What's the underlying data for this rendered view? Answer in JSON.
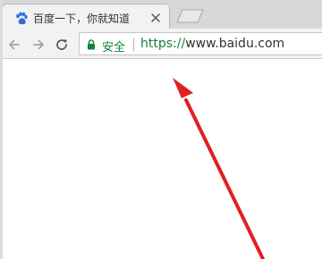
{
  "browser": {
    "tab": {
      "title": "百度一下，你就知道",
      "favicon": "baidu-paw-icon",
      "close_icon": "close-icon"
    },
    "new_tab_icon": "new-tab-icon",
    "nav": {
      "back_icon": "back-arrow-icon",
      "forward_icon": "forward-arrow-icon",
      "reload_icon": "reload-icon"
    },
    "address": {
      "security_label": "安全",
      "url_scheme": "https://",
      "url_host": "www.baidu.com"
    }
  },
  "annotation": {
    "arrow_color": "#e02020",
    "arrow_icon": "red-arrow-icon"
  },
  "colors": {
    "secure_green": "#188038",
    "baidu_blue": "#2f6be6",
    "tab_bg": "#f2f2f2",
    "tabbar_bg": "#d7d7d7"
  }
}
